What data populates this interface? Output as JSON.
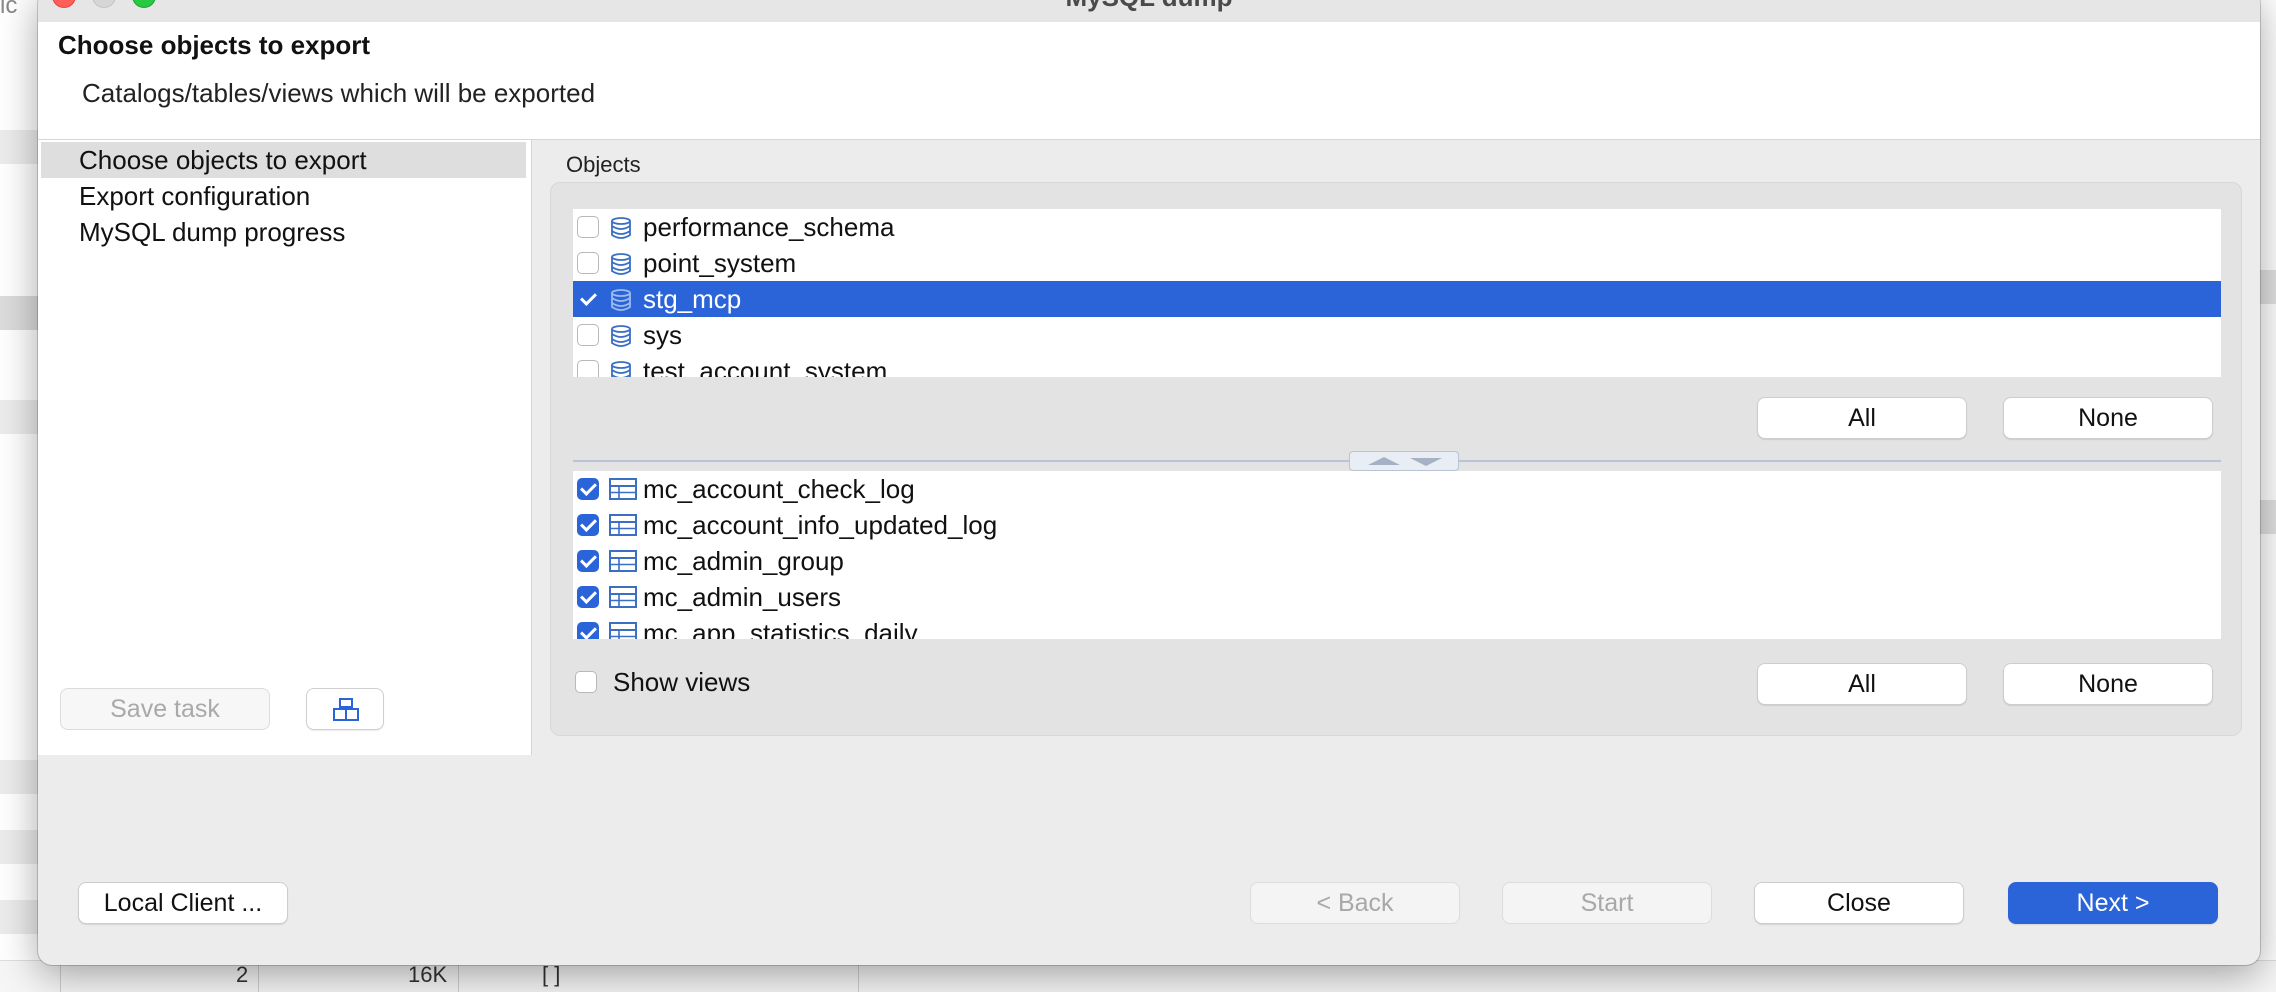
{
  "window": {
    "title": "MySQL dump"
  },
  "header": {
    "title": "Choose objects to export",
    "description": "Catalogs/tables/views which will be exported"
  },
  "nav": {
    "items": [
      {
        "label": "Choose objects to export",
        "selected": true
      },
      {
        "label": "Export configuration",
        "selected": false
      },
      {
        "label": "MySQL dump progress",
        "selected": false
      }
    ],
    "save_task_label": "Save task",
    "tool_icon": "task-config-icon"
  },
  "objects": {
    "label": "Objects",
    "catalogs": [
      {
        "name": "performance_schema",
        "checked": false,
        "selected": false,
        "icon": "database-icon"
      },
      {
        "name": "point_system",
        "checked": false,
        "selected": false,
        "icon": "database-icon"
      },
      {
        "name": "stg_mcp",
        "checked": true,
        "selected": true,
        "icon": "database-icon"
      },
      {
        "name": "sys",
        "checked": false,
        "selected": false,
        "icon": "database-icon"
      },
      {
        "name": "test_account_system",
        "checked": false,
        "selected": false,
        "icon": "database-icon"
      }
    ],
    "catalog_all_label": "All",
    "catalog_none_label": "None",
    "tables": [
      {
        "name": "mc_account_check_log",
        "checked": true,
        "icon": "table-icon"
      },
      {
        "name": "mc_account_info_updated_log",
        "checked": true,
        "icon": "table-icon"
      },
      {
        "name": "mc_admin_group",
        "checked": true,
        "icon": "table-icon"
      },
      {
        "name": "mc_admin_users",
        "checked": true,
        "icon": "table-icon"
      },
      {
        "name": "mc_app_statistics_daily",
        "checked": true,
        "icon": "table-icon"
      }
    ],
    "show_views_label": "Show views",
    "show_views_checked": false,
    "table_all_label": "All",
    "table_none_label": "None"
  },
  "footer": {
    "local_client_label": "Local Client ...",
    "back_label": "< Back",
    "start_label": "Start",
    "close_label": "Close",
    "next_label": "Next >"
  },
  "background": {
    "corner_text": "lc",
    "row_number": "2",
    "row_size": "16K",
    "row_value": "[ ]"
  },
  "colors": {
    "accent": "#2a64d8",
    "close_button": "#ff5f57",
    "zoom_button": "#28c840"
  }
}
